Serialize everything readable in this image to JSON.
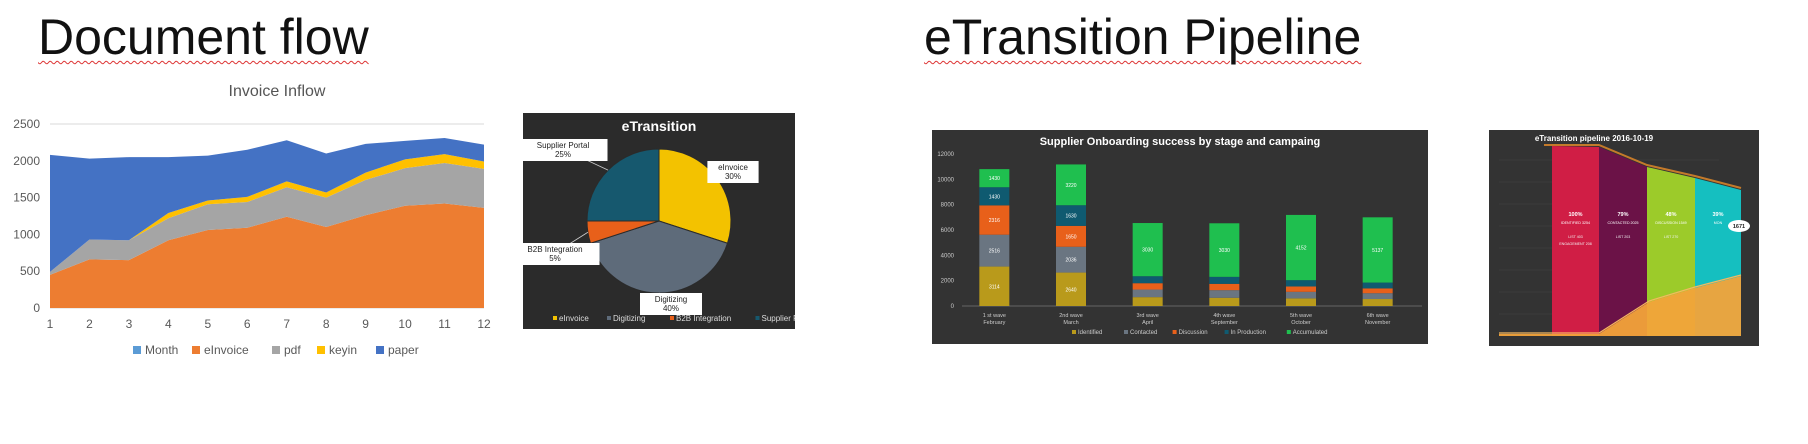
{
  "titles": {
    "left": "Document flow",
    "right": "eTransition Pipeline"
  },
  "chart_data": [
    {
      "type": "area",
      "title": "Invoice Inflow",
      "stacked": true,
      "x": [
        1,
        2,
        3,
        4,
        5,
        6,
        7,
        8,
        9,
        10,
        11,
        12
      ],
      "ylim": [
        0,
        2500
      ],
      "yticks": [
        0,
        500,
        1000,
        1500,
        2000,
        2500
      ],
      "grid": true,
      "legend_position": "bottom",
      "legend": [
        "Month",
        "eInvoice",
        "pdf",
        "keyin",
        "paper"
      ],
      "series": [
        {
          "name": "eInvoice",
          "color": "#ed7d31",
          "values": [
            450,
            660,
            650,
            920,
            1060,
            1090,
            1240,
            1100,
            1260,
            1390,
            1420,
            1360
          ]
        },
        {
          "name": "pdf",
          "color": "#a5a5a5",
          "values": [
            40,
            270,
            270,
            300,
            350,
            350,
            400,
            400,
            480,
            510,
            550,
            530
          ]
        },
        {
          "name": "keyin",
          "color": "#ffc000",
          "values": [
            0,
            0,
            0,
            70,
            50,
            70,
            80,
            70,
            100,
            120,
            120,
            100
          ]
        },
        {
          "name": "paper",
          "color": "#4472c4",
          "values": [
            1590,
            1100,
            1130,
            760,
            610,
            640,
            560,
            530,
            390,
            250,
            220,
            230
          ]
        }
      ],
      "colors": {
        "Month": "#5b9bd5"
      }
    },
    {
      "type": "pie",
      "title": "eTransition",
      "slices": [
        {
          "name": "eInvoice",
          "value": 30,
          "label": "eInvoice\n30%",
          "color": "#f3c200"
        },
        {
          "name": "Digitizing",
          "value": 40,
          "label": "Digitizing\n40%",
          "color": "#5e6b7a"
        },
        {
          "name": "B2B Integration",
          "value": 5,
          "label": "B2B Integration\n5%",
          "color": "#e8601a"
        },
        {
          "name": "Supplier Portal",
          "value": 25,
          "label": "Supplier Portal\n25%",
          "color": "#16586e"
        }
      ],
      "legend_position": "bottom",
      "background": "#2b2b2b"
    },
    {
      "type": "bar",
      "stacked": true,
      "title": "Supplier Onboarding success by stage and campaing",
      "ylim": [
        0,
        12000
      ],
      "yticks": [
        "0",
        "2000",
        "4000",
        "6000",
        "8000",
        "10000",
        "12000"
      ],
      "categories": [
        "1 st wave\nFebruary",
        "2nd wave\nMarch",
        "3rd wave\nApril",
        "4th wave\nSeptember",
        "5th wave\nOctober",
        "6th wave\nNovember"
      ],
      "legend_position": "bottom",
      "legend": [
        "Identified",
        "Contacted",
        "Discussion",
        "In Production",
        "Accumulated"
      ],
      "series": [
        {
          "name": "Identified",
          "color": "#b99a1b",
          "values": [
            3114,
            2640,
            700,
            650,
            600,
            550
          ],
          "labels": [
            "3114",
            "2640",
            "",
            "",
            "",
            ""
          ]
        },
        {
          "name": "Contacted",
          "color": "#6a7581",
          "values": [
            2516,
            2036,
            600,
            600,
            520,
            460
          ],
          "labels": [
            "2516",
            "2036",
            "",
            "",
            "",
            ""
          ]
        },
        {
          "name": "Discussion",
          "color": "#e8601a",
          "values": [
            2316,
            1650,
            500,
            500,
            420,
            380
          ],
          "labels": [
            "2316",
            "1650",
            "",
            "",
            "",
            ""
          ]
        },
        {
          "name": "In Production",
          "color": "#0f5a70",
          "values": [
            1430,
            1630,
            550,
            550,
            500,
            460
          ],
          "labels": [
            "1430",
            "1630",
            "",
            "",
            "",
            ""
          ]
        },
        {
          "name": "Accumulated",
          "color": "#1fbf4f",
          "values": [
            1430,
            3220,
            4200,
            4230,
            5150,
            5151
          ],
          "labels": [
            "1430",
            "3220",
            "3030",
            "3030",
            "4152",
            "5137"
          ]
        }
      ],
      "background": "#333333"
    },
    {
      "type": "area",
      "title": "eTransition pipeline 2016-10-19",
      "segments": [
        {
          "color": "#d01e45",
          "pct": "100%",
          "label": "IDENTIFIED 3254",
          "sub": "LIST 403\nENGAGEMENT 208"
        },
        {
          "color": "#6b1247",
          "pct": "79%",
          "label": "CONTACTED 2025",
          "sub": "LIST 203"
        },
        {
          "color": "#9ccb2a",
          "pct": "48%",
          "label": "DISCUSSION 1549",
          "sub": "LIST 270"
        },
        {
          "color": "#15bfc0",
          "pct": "39%",
          "label": "MON",
          "sub": ""
        }
      ],
      "badge": "1671",
      "background": "#333333"
    }
  ]
}
